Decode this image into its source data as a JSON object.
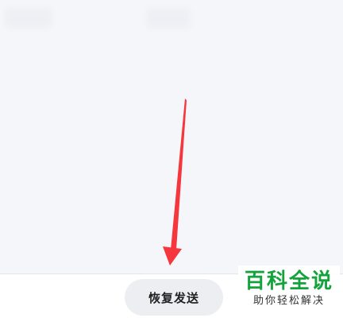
{
  "bottom_bar": {
    "restore_send_label": "恢复发送"
  },
  "watermark": {
    "title": "百科全说",
    "subtitle": "助你轻松解决"
  },
  "colors": {
    "arrow": "#f5363c",
    "watermark_green": "#13a33b",
    "background": "#f5f6fa"
  }
}
